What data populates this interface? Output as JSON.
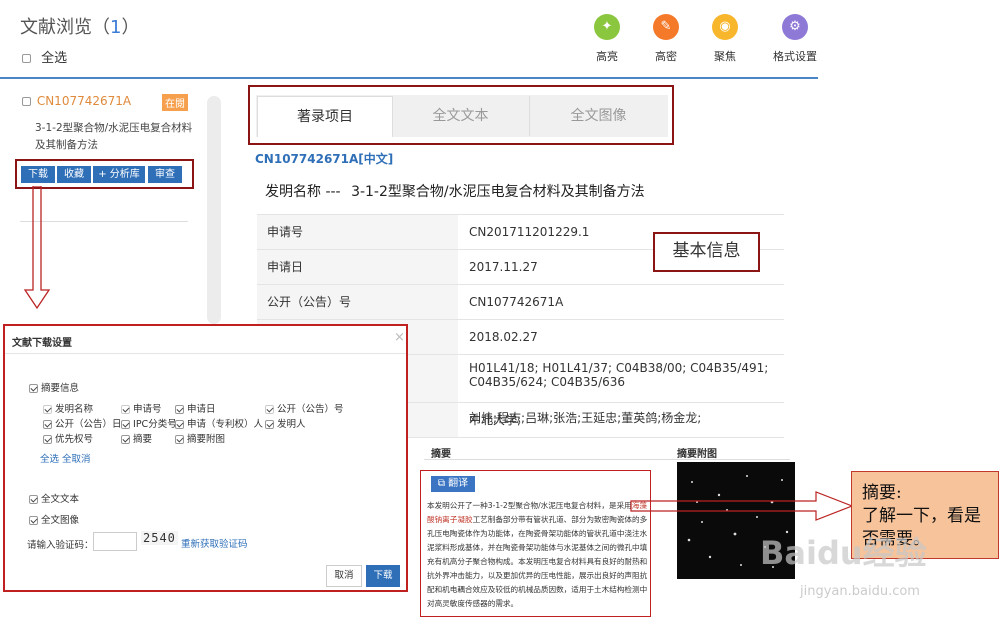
{
  "header": {
    "title": "文献浏览",
    "count": "1",
    "select_all": "全选",
    "tools": [
      {
        "label": "高亮",
        "icon": "bulb-icon",
        "color": "#8bc63f"
      },
      {
        "label": "高密",
        "icon": "edit-icon",
        "color": "#f47a2a"
      },
      {
        "label": "聚焦",
        "icon": "eye-icon",
        "color": "#f8b62d"
      },
      {
        "label": "格式设置",
        "icon": "gear-icon",
        "color": "#8e7ad6"
      }
    ]
  },
  "result": {
    "number": "CN107742671A",
    "status": "在閱",
    "title": "3-1-2型聚合物/水泥压电复合材料及其制备方法",
    "buttons": [
      "下载",
      "收藏",
      "+ 分析库",
      "审查"
    ]
  },
  "tabs": [
    "著录项目",
    "全文文本",
    "全文图像"
  ],
  "doc": {
    "id_line": "CN107742671A[中文]",
    "invention_label": "发明名称 ---",
    "invention_name": "3-1-2型聚合物/水泥压电复合材料及其制备方法",
    "fields": [
      {
        "k": "申请号",
        "v": "CN201711201229.1"
      },
      {
        "k": "申请日",
        "v": "2017.11.27"
      },
      {
        "k": "公开（公告）号",
        "v": "CN107742671A"
      },
      {
        "k": "公开（公告）日",
        "v": "2018.02.27"
      },
      {
        "k": "",
        "v": "H01L41/18; H01L41/37; C04B38/00; C04B35/491; C04B35/624; C04B35/636"
      },
      {
        "k": "",
        "v": "中北大学;"
      },
      {
        "k": "",
        "v": "刘炜;程志;吕琳;张浩;王延忠;董英鸽;杨金龙;"
      }
    ],
    "basic_info_note": "基本信息"
  },
  "abstract": {
    "heading": "摘要",
    "figure_heading": "摘要附图",
    "translate": "翻译",
    "text_pre": "本发明公开了一种3-1-2型聚合物/水泥压电复合材料，是采用",
    "text_highlight": "海藻酸钠离子凝胶",
    "text_post": "工艺制备部分带有管状孔道、部分为致密陶瓷体的多孔压电陶瓷体作为功能体，在陶瓷骨架功能体的管状孔道中浇注水泥浆料形成基体，并在陶瓷骨架功能体与水泥基体之间的微孔中填充有机高分子聚合物构成。本发明压电复合材料具有良好的耐热和抗外界冲击能力，以及更加优异的压电性能，展示出良好的声阻抗配和机电耦合效应及较低的机械品质因数，适用于土木结构检测中对高灵敏度传感器的需求。",
    "note_title": "摘要:",
    "note_body": "了解一下，看是否需要。"
  },
  "dialog": {
    "title": "文献下载设置",
    "close": "×",
    "section_abstract": "摘要信息",
    "options": [
      [
        "发明名称",
        "申请号",
        "申请日",
        "公开（公告）号"
      ],
      [
        "公开（公告）日",
        "IPC分类号",
        "申请（专利权）人",
        "发明人"
      ],
      [
        "优先权号",
        "摘要",
        "摘要附图"
      ]
    ],
    "select_all": "全选",
    "deselect_all": "全取消",
    "fulltext": "全文文本",
    "fullimage": "全文图像",
    "captcha_label": "请输入验证码：",
    "captcha": "2540",
    "refresh": "重新获取验证码",
    "cancel": "取消",
    "download": "下载"
  },
  "watermark": {
    "brand": "Baidu经验",
    "url": "jingyan.baidu.com"
  }
}
